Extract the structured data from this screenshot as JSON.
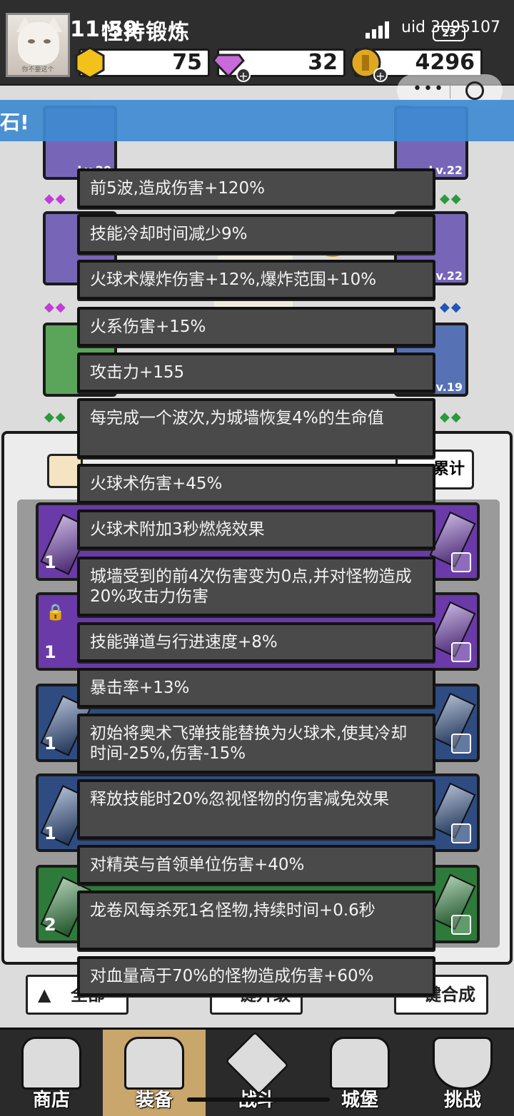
{
  "status": {
    "time": "11:59",
    "battery": "23"
  },
  "header": {
    "title": "怪持锻炼",
    "uid": "uid 3095107",
    "avatar_caption": "你不要这个"
  },
  "resources": [
    {
      "name": "gold-hex",
      "value": "75",
      "color": "#f2c21a"
    },
    {
      "name": "diamond",
      "value": "32",
      "color": "#c86ad8"
    },
    {
      "name": "coin",
      "value": "4296",
      "color": "#e0a821"
    }
  ],
  "banner": {
    "text": "石!"
  },
  "panel": {
    "right_tab": "累计"
  },
  "rows": [
    {
      "count": "1"
    },
    {
      "count": "1"
    },
    {
      "count": "1"
    },
    {
      "count": "1"
    },
    {
      "count": "2"
    }
  ],
  "bottom_buttons": {
    "all": "全部",
    "upgrade": "一键升级",
    "merge": "一键合成"
  },
  "nav": [
    {
      "label": "商店",
      "icon": "shop-icon"
    },
    {
      "label": "装备",
      "icon": "equipment-bag-icon"
    },
    {
      "label": "战斗",
      "icon": "crossed-swords-icon"
    },
    {
      "label": "城堡",
      "icon": "castle-icon"
    },
    {
      "label": "挑战",
      "icon": "challenge-shield-icon"
    }
  ],
  "tooltips": [
    "前5波,造成伤害+120%",
    "技能冷却时间减少9%",
    "火球术爆炸伤害+12%,爆炸范围+10%",
    "火系伤害+15%",
    "攻击力+155",
    "每完成一个波次,为城墙恢复4%的生命值",
    "火球术伤害+45%",
    "火球术附加3秒燃烧效果",
    "城墙受到的前4次伤害变为0点,并对怪物造成20%攻击力伤害",
    "技能弹道与行进速度+8%",
    "暴击率+13%",
    "初始将奥术飞弹技能替换为火球术,使其冷却时间-25%,伤害-15%",
    "释放技能时20%忽视怪物的伤害减免效果",
    "对精英与首领单位伤害+40%",
    "龙卷风每杀死1名怪物,持续时间+0.6秒",
    "对血量高于70%的怪物造成伤害+60%"
  ]
}
